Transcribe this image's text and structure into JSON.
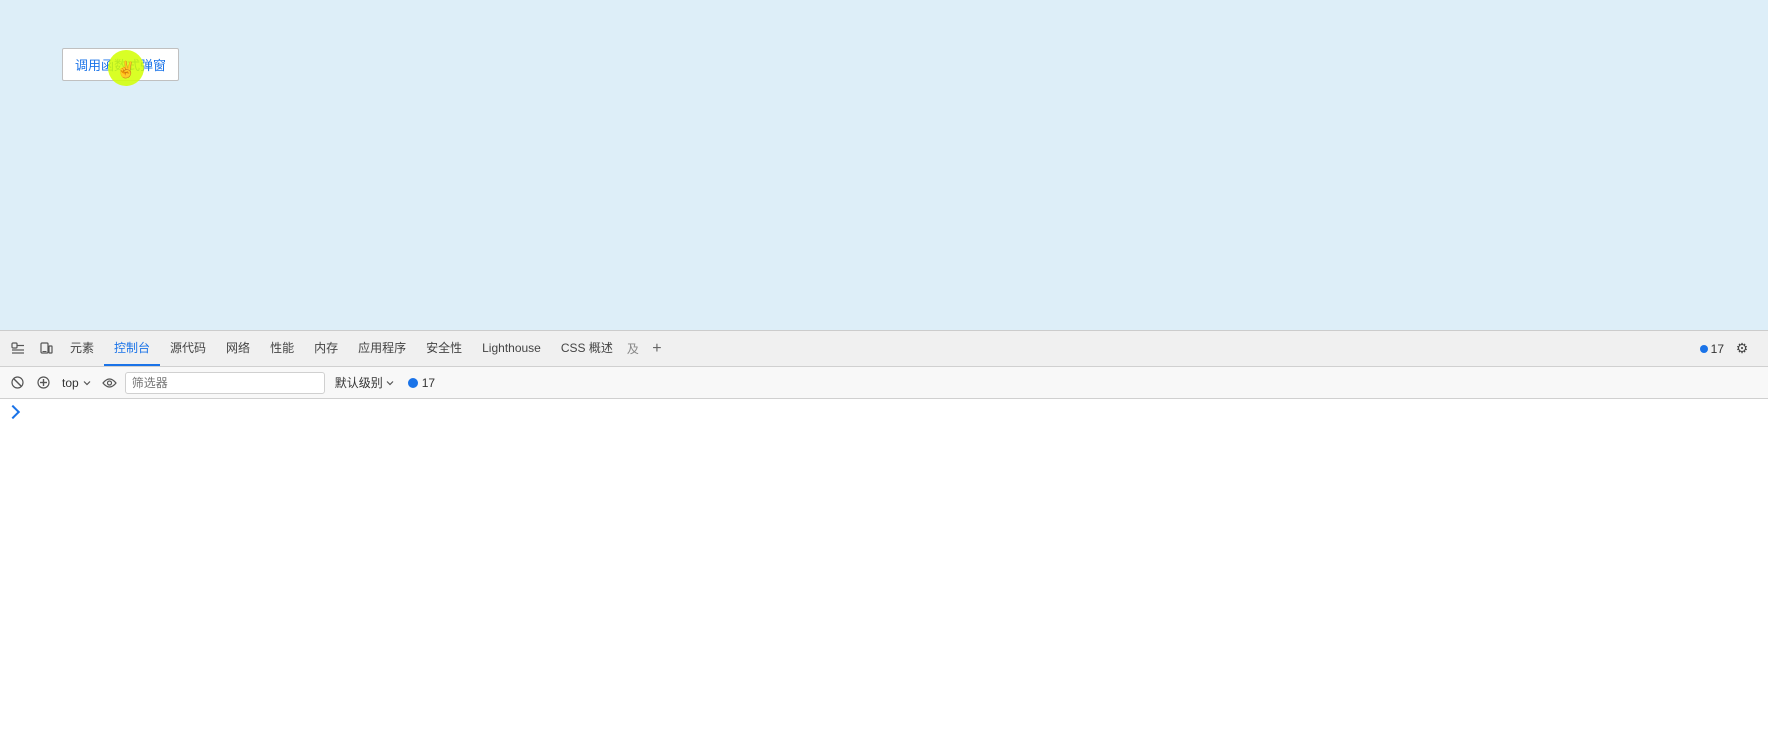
{
  "page": {
    "button_label": "调用函数式弹窗",
    "background_color": "#ddeef8"
  },
  "devtools": {
    "tabs": [
      {
        "id": "elements",
        "label": "元素",
        "active": false
      },
      {
        "id": "console",
        "label": "控制台",
        "active": true
      },
      {
        "id": "sources",
        "label": "源代码",
        "active": false
      },
      {
        "id": "network",
        "label": "网络",
        "active": false
      },
      {
        "id": "performance",
        "label": "性能",
        "active": false
      },
      {
        "id": "memory",
        "label": "内存",
        "active": false
      },
      {
        "id": "application",
        "label": "应用程序",
        "active": false
      },
      {
        "id": "security",
        "label": "安全性",
        "active": false
      },
      {
        "id": "lighthouse",
        "label": "Lighthouse",
        "active": false
      },
      {
        "id": "css-overview",
        "label": "CSS 概述",
        "active": false
      }
    ],
    "toolbar": {
      "context_label": "top",
      "filter_placeholder": "筛选器",
      "level_label": "默认级别",
      "message_count": "17",
      "preserve_log": false,
      "clear_label": "清空控制台"
    },
    "console_content": {
      "expand_label": ""
    },
    "right_icons": {
      "message_count": "17"
    }
  }
}
